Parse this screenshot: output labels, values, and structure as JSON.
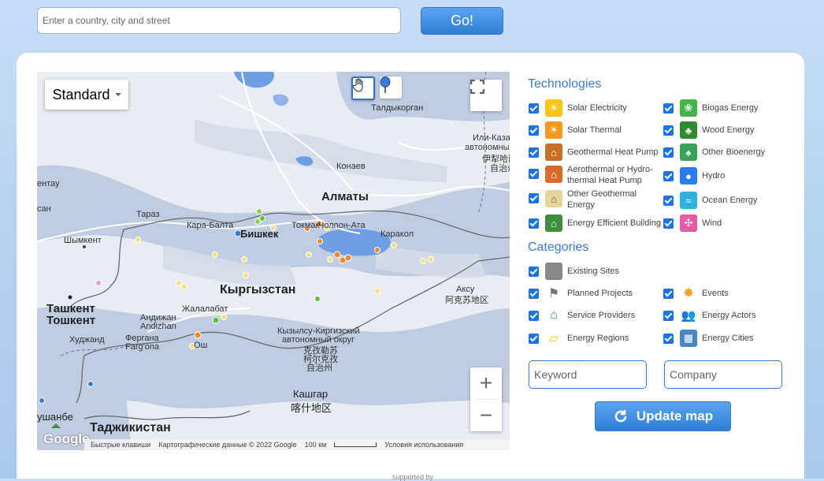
{
  "search": {
    "placeholder": "Enter a country, city and street",
    "go_label": "Go!"
  },
  "map": {
    "type_selector": "Standard",
    "labels": {
      "taldykorgan": "Талдыкорган",
      "ili_kaz": "Или-Каза",
      "ili_aut": "автономны",
      "ili_cn1": "伊犁哈萨",
      "ili_cn2": "自治州",
      "konaev": "Конаев",
      "almaty": "Алматы",
      "taraz": "Тараз",
      "karabalta": "Кара-Балта",
      "bishkek": "Бишкек",
      "tokmak": "Токмак",
      "cholpon": "Чолпон-Ата",
      "karakol": "Каракол",
      "shymkent": "Шымкент",
      "kyrgyzstan": "Кыргызстан",
      "aksu": "Аксу",
      "aksu_cn": "阿克苏地区",
      "tashkent1": "Ташкент",
      "tashkent2": "Тошкент",
      "jalalabad": "Жалалабат",
      "andijan1": "Андижан",
      "andijan2": "Andizhan",
      "khujand": "Худжанд",
      "fergana1": "Фергана",
      "fergana2": "Farg'ona",
      "osh": "Ош",
      "kizil1": "Кызылсу-Киргизский",
      "kizil2": "автономный округ",
      "kizil_cn1": "克孜勒苏",
      "kizil_cn2": "柯尔克孜",
      "kizil_cn3": "自治州",
      "kashgar": "Кашгар",
      "kashgar_cn": "喀什地区",
      "dushanbe": "ушанбе",
      "tajikistan": "Таджикистан",
      "kent": "ентау",
      "san": "сан"
    },
    "google": "Google",
    "attribution": {
      "shortcuts": "Быстрые клавиши",
      "data": "Картографические данные © 2022 Google",
      "scale": "100 км",
      "terms": "Условия использования"
    }
  },
  "technologies": {
    "title": "Technologies",
    "left": [
      {
        "label": "Solar Electricity",
        "icon": "solar-electricity-icon",
        "color": "#f5c518"
      },
      {
        "label": "Solar Thermal",
        "icon": "solar-thermal-icon",
        "color": "#f39a1e"
      },
      {
        "label": "Geothermal Heat Pump",
        "icon": "geothermal-icon",
        "color": "#c8702a"
      },
      {
        "label": "Aerothermal or Hydro-thermal Heat Pump",
        "icon": "aerothermal-icon",
        "color": "#d86a2c"
      },
      {
        "label": "Other Geothermal Energy",
        "icon": "other-geothermal-icon",
        "color": "#e6d49a"
      },
      {
        "label": "Energy Efficient Building",
        "icon": "efficient-building-icon",
        "color": "#3e8e3e"
      }
    ],
    "right": [
      {
        "label": "Biogas Energy",
        "icon": "biogas-icon",
        "color": "#45b24a"
      },
      {
        "label": "Wood Energy",
        "icon": "wood-icon",
        "color": "#2e8b2e"
      },
      {
        "label": "Other Bioenergy",
        "icon": "bioenergy-icon",
        "color": "#3aa35a"
      },
      {
        "label": "Hydro",
        "icon": "hydro-icon",
        "color": "#2b7de9"
      },
      {
        "label": "Ocean Energy",
        "icon": "ocean-icon",
        "color": "#2fb1e0"
      },
      {
        "label": "Wind",
        "icon": "wind-icon",
        "color": "#e65aa5"
      }
    ]
  },
  "categories": {
    "title": "Categories",
    "left": [
      {
        "label": "Existing Sites",
        "icon": "existing-sites-icon",
        "color": "#888888"
      },
      {
        "label": "Planned Projects",
        "icon": "planned-projects-icon",
        "color": "#777777"
      },
      {
        "label": "Service Providers",
        "icon": "service-providers-icon",
        "color": "#3a7bd5"
      },
      {
        "label": "Energy Regions",
        "icon": "energy-regions-icon",
        "color": "#e8d400"
      }
    ],
    "right": [
      {
        "label": "Events",
        "icon": "events-icon",
        "color": "#f0a020"
      },
      {
        "label": "Energy Actors",
        "icon": "energy-actors-icon",
        "color": "#3a7bd5"
      },
      {
        "label": "Energy Cities",
        "icon": "energy-cities-icon",
        "color": "#4a86c6"
      }
    ]
  },
  "filters": {
    "keyword_placeholder": "Keyword",
    "company_placeholder": "Company"
  },
  "update_label": "Update map",
  "footer": {
    "supported": "supported by"
  }
}
